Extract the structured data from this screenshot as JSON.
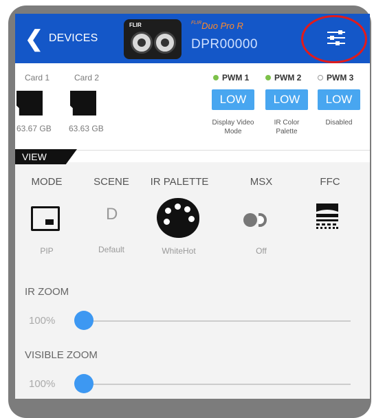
{
  "header": {
    "back_label": "DEVICES",
    "camera_brand": "FLIR",
    "model_brand": "FLIR",
    "model_name": "Duo Pro R",
    "serial": "DPR00000"
  },
  "colors": {
    "header_bg": "#1457c8",
    "accent_button": "#48a6f0",
    "slider_thumb": "#3d98f2",
    "highlight_ring": "#e11b1b",
    "pwm_on": "#7dc14a"
  },
  "cards": [
    {
      "label": "Card 1",
      "size": "63.67 GB"
    },
    {
      "label": "Card 2",
      "size": "63.63 GB"
    }
  ],
  "pwm": [
    {
      "label": "PWM 1",
      "active": true,
      "level": "LOW",
      "mode": "Display Video Mode"
    },
    {
      "label": "PWM 2",
      "active": true,
      "level": "LOW",
      "mode": "IR Color Palette"
    },
    {
      "label": "PWM 3",
      "active": false,
      "level": "LOW",
      "mode": "Disabled"
    }
  ],
  "view": {
    "tab_label": "VIEW",
    "columns": [
      {
        "heading": "MODE",
        "value": "PIP",
        "icon": "pip-mode-icon"
      },
      {
        "heading": "SCENE",
        "value": "Default",
        "icon": "scene-d-icon",
        "icon_text": "D"
      },
      {
        "heading": "IR PALETTE",
        "value": "WhiteHot",
        "icon": "palette-icon"
      },
      {
        "heading": "MSX",
        "value": "Off",
        "icon": "msx-toggle-icon"
      },
      {
        "heading": "FFC",
        "value": "",
        "icon": "ffc-shutter-icon"
      }
    ]
  },
  "sliders": [
    {
      "label": "IR ZOOM",
      "value_text": "100%",
      "fraction": 0.0
    },
    {
      "label": "VISIBLE ZOOM",
      "value_text": "100%",
      "fraction": 0.0
    }
  ]
}
